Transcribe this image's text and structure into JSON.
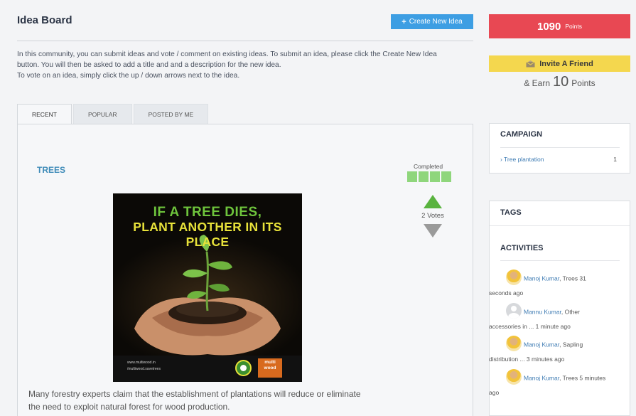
{
  "header": {
    "title": "Idea Board",
    "create_button": "Create New Idea",
    "create_icon": "plus-icon"
  },
  "intro": {
    "line1": "In this community, you can submit ideas and vote / comment on existing ideas. To submit an idea, please click the Create New Idea",
    "line2": "button. You will then be asked to add a title and and a description for the new idea.",
    "line3": "To vote on an idea, simply click the up / down arrows next to the idea."
  },
  "tabs": [
    "RECENT",
    "POPULAR",
    "POSTED BY ME"
  ],
  "idea": {
    "title": "TREES",
    "status": "Completed",
    "status_progress": 1.0,
    "votes": "2 Votes",
    "poster": {
      "line1": "IF A TREE DIES,",
      "line2": "PLANT ANOTHER IN ITS PLACE",
      "footer1": "www.multiwood.in",
      "footer2": "/multiwood.savetrees",
      "brand": "multi wood"
    },
    "description_line1": "Many forestry experts claim that the establishment of plantations will reduce or eliminate",
    "description_line2": "the need to exploit natural forest for wood production."
  },
  "sidebar": {
    "points_value": "1090",
    "points_unit": "Points",
    "invite_label": "Invite A Friend",
    "invite_icon": "envelope-icon",
    "earn_prefix": "& Earn",
    "earn_value": "10",
    "earn_unit": "Points",
    "campaign": {
      "title": "CAMPAIGN",
      "items": [
        {
          "name": "Tree plantation",
          "count": "1"
        }
      ]
    },
    "tags": {
      "title": "TAGS"
    },
    "activities": {
      "title": "ACTIVITIES",
      "items": [
        {
          "user": "Manoj Kumar",
          "rest1": ", Trees  31",
          "rest2": "seconds ago"
        },
        {
          "user": "Mannu Kumar",
          "rest1": ", Other",
          "rest2": "accessories in ...  1 minute ago"
        },
        {
          "user": "Manoj Kumar",
          "rest1": ", Sapling",
          "rest2": "distribution ...  3 minutes ago"
        },
        {
          "user": "Manoj Kumar",
          "rest1": ", Trees  5 minutes",
          "rest2": "ago"
        }
      ]
    }
  },
  "colors": {
    "accent_blue": "#3d9ee3",
    "points_red": "#e84853",
    "invite_yellow": "#f4d74e",
    "status_green": "#8fd67c",
    "vote_up": "#59b33f",
    "vote_down": "#9a9a9a"
  }
}
